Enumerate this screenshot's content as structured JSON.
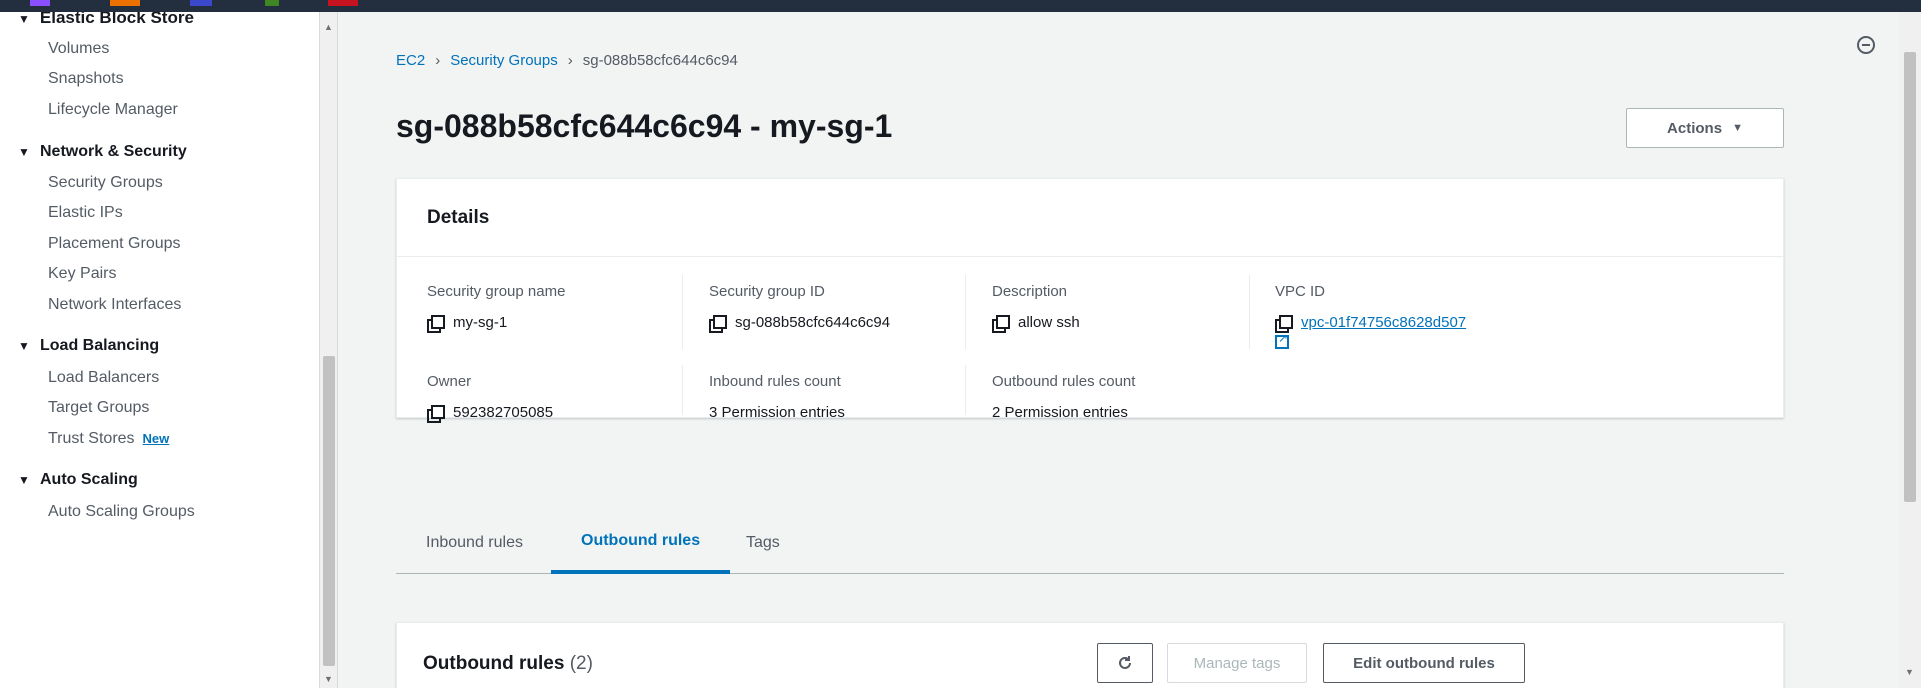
{
  "sidebar": {
    "cut_section": "Elastic Block Store",
    "ebs_items": [
      "Volumes",
      "Snapshots",
      "Lifecycle Manager"
    ],
    "network_section": "Network & Security",
    "network_items": [
      "Security Groups",
      "Elastic IPs",
      "Placement Groups",
      "Key Pairs",
      "Network Interfaces"
    ],
    "lb_section": "Load Balancing",
    "lb_items": [
      "Load Balancers",
      "Target Groups",
      "Trust Stores"
    ],
    "new_badge": "New",
    "as_section": "Auto Scaling",
    "as_items": [
      "Auto Scaling Groups"
    ]
  },
  "breadcrumb": {
    "root": "EC2",
    "parent": "Security Groups",
    "current": "sg-088b58cfc644c6c94"
  },
  "page": {
    "title": "sg-088b58cfc644c6c94 - my-sg-1",
    "actions_label": "Actions"
  },
  "details": {
    "heading": "Details",
    "sg_name_label": "Security group name",
    "sg_name": "my-sg-1",
    "sg_id_label": "Security group ID",
    "sg_id": "sg-088b58cfc644c6c94",
    "description_label": "Description",
    "description": "allow ssh",
    "vpc_label": "VPC ID",
    "vpc_id": "vpc-01f74756c8628d507",
    "owner_label": "Owner",
    "owner": "592382705085",
    "inbound_count_label": "Inbound rules count",
    "inbound_count": "3 Permission entries",
    "outbound_count_label": "Outbound rules count",
    "outbound_count": "2 Permission entries"
  },
  "tabs": [
    "Inbound rules",
    "Outbound rules",
    "Tags"
  ],
  "active_tab": "Outbound rules",
  "outbound": {
    "title": "Outbound rules",
    "count": "(2)",
    "manage_tags_label": "Manage tags",
    "edit_label": "Edit outbound rules"
  },
  "colors": {
    "link": "#0073bb",
    "topbar": "#232f3e"
  }
}
